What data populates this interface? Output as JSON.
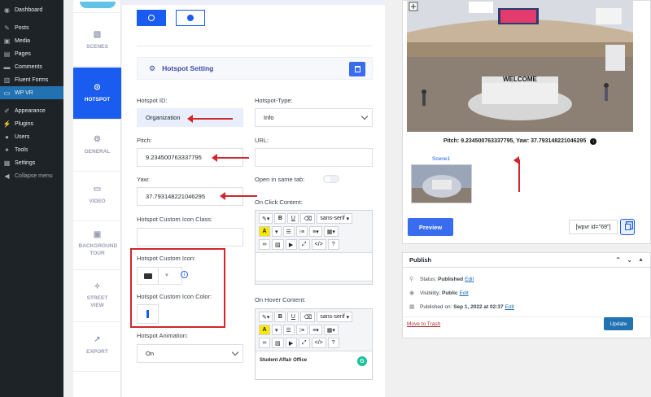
{
  "wp_menu": {
    "items": [
      {
        "label": "Dashboard",
        "icon": "dashboard-icon"
      },
      {
        "label": "Posts",
        "icon": "pin-icon"
      },
      {
        "label": "Media",
        "icon": "media-icon"
      },
      {
        "label": "Pages",
        "icon": "page-icon"
      },
      {
        "label": "Comments",
        "icon": "comment-icon"
      },
      {
        "label": "Fluent Forms",
        "icon": "form-icon"
      },
      {
        "label": "WP VR",
        "icon": "vr-icon",
        "active": true
      },
      {
        "label": "Appearance",
        "icon": "brush-icon"
      },
      {
        "label": "Plugins",
        "icon": "plugin-icon"
      },
      {
        "label": "Users",
        "icon": "user-icon"
      },
      {
        "label": "Tools",
        "icon": "wrench-icon"
      },
      {
        "label": "Settings",
        "icon": "settings-icon"
      },
      {
        "label": "Collapse menu",
        "icon": "collapse-icon"
      }
    ]
  },
  "tabs": {
    "scenes": "SCENES",
    "hotspot": "HOTSPOT",
    "general": "GENERAL",
    "video": "VIDEO",
    "background_tour": "BACKGROUND TOUR",
    "street_view": "STREET VIEW",
    "export": "EXPORT"
  },
  "hotspot": {
    "section_title": "Hotspot Setting",
    "id_label": "Hotspot ID:",
    "id_value": "Organization",
    "type_label": "Hotspot-Type:",
    "type_value": "Info",
    "pitch_label": "Pitch:",
    "pitch_value": "9.234500763337795",
    "url_label": "URL:",
    "yaw_label": "Yaw:",
    "yaw_value": "37.793148221046295",
    "open_same_tab_label": "Open in same tab:",
    "on_click_label": "On Click Content:",
    "custom_icon_class_label": "Hotspot Custom Icon Class:",
    "custom_icon_label": "Hotspot Custom Icon:",
    "custom_icon_color_label": "Hotspot Custom Icon Color:",
    "on_hover_label": "On Hover Content:",
    "hover_content": "Student Affair Office",
    "animation_label": "Hotspot Animation:",
    "animation_value": "On"
  },
  "editor_toolbar": {
    "bold": "B",
    "underline": "U",
    "font": "sans-serif",
    "color": "A",
    "code": "</>",
    "help": "?"
  },
  "preview": {
    "pitch_yaw_text": "Pitch: 9.234500763337795, Yaw: 37.793148221046295",
    "pano_sign": "WELCOME",
    "scene_label": "Scene1",
    "preview_button": "Preview",
    "shortcode": "[wpvr id=\"69\"]"
  },
  "publish": {
    "title": "Publish",
    "status_label": "Status:",
    "status_value": "Published",
    "visibility_label": "Visibility:",
    "visibility_value": "Public",
    "published_label": "Published on:",
    "published_value": "Sep 1, 2022 at 02:37",
    "edit": "Edit",
    "trash": "Move to Trash",
    "update": "Update"
  },
  "colors": {
    "accent": "#1a5bf0",
    "wp_sidebar": "#1d2327",
    "annotation_red": "#d0262c"
  }
}
